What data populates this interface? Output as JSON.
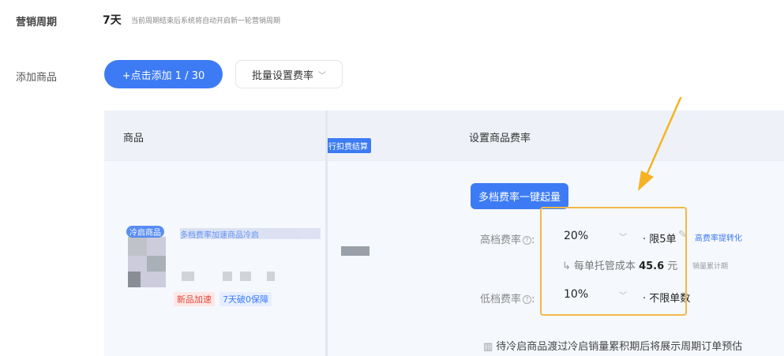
{
  "period": {
    "label": "营销周期",
    "value": "7天",
    "note": "当前周期结束后系统将自动开启新一轮营销周期"
  },
  "add_product": {
    "label": "添加商品",
    "add_button": "+点击添加 1 / 30",
    "batch_button": "批量设置费率"
  },
  "table": {
    "col_product": "商品",
    "col_rate": "设置商品费率",
    "col_mid_badge": "行扣费结算",
    "product": {
      "tag": "冷启商品",
      "name": "多档费率加速商品冷启",
      "badge_new": "新品加速",
      "badge_guard": "7天破0保障"
    },
    "multi_rate_button": "多档费率一键起量",
    "high": {
      "label": "高档费率",
      "value": "20%",
      "limit": "· 限5单",
      "conversion": "高费率提转化"
    },
    "cost": {
      "prefix": "每单托管成本",
      "amount": "45.6",
      "unit": "元",
      "period_note": "销量累计期"
    },
    "low": {
      "label": "低档费率",
      "value": "10%",
      "limit": "· 不限单数"
    },
    "footer_note": "待冷启商品渡过冷启销量累积期后将展示周期订单预估"
  },
  "colors": {
    "accent": "#3d7bf5",
    "highlight": "#f2b84a",
    "new_badge": "#e5483b"
  }
}
